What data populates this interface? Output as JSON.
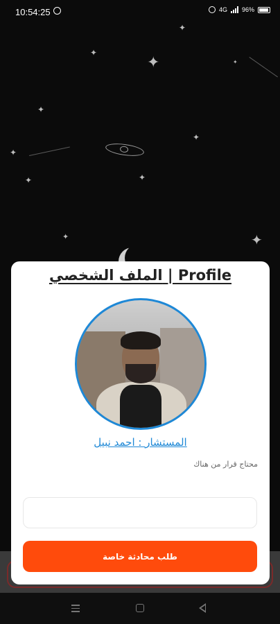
{
  "status_bar": {
    "time": "10:54:25",
    "network_label": "4G",
    "battery_percent": "96%",
    "icons": [
      "whatsapp-icon",
      "alarm-icon",
      "signal-icon",
      "battery-icon"
    ]
  },
  "profile": {
    "title": "الملف الشخصي | Profile",
    "advisor_name": "المستشار : احمد نبيل",
    "bio": "محتاج قرار من هناك",
    "message_placeholder": "",
    "request_button_label": "طلب محادثة خاصة"
  },
  "colors": {
    "accent": "#ff4b0c",
    "link": "#1e88d6",
    "background": "#0b0b0b",
    "card": "#ffffff"
  },
  "nav_bar": {
    "icons": [
      "menu-icon",
      "home-icon",
      "back-icon"
    ]
  }
}
